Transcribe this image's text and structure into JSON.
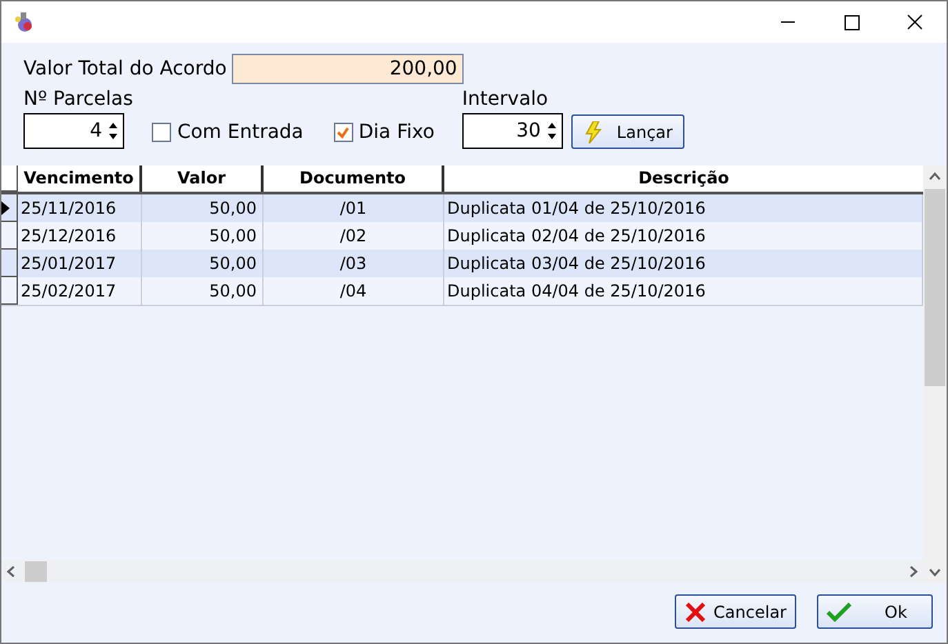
{
  "form": {
    "total_label": "Valor Total do Acordo",
    "total_value": "200,00",
    "parcelas_label": "Nº Parcelas",
    "parcelas_value": "4",
    "com_entrada": {
      "label": "Com Entrada",
      "checked": false
    },
    "dia_fixo": {
      "label": "Dia Fixo",
      "checked": true
    },
    "intervalo_label": "Intervalo",
    "intervalo_value": "30",
    "lancar": "Lançar"
  },
  "table": {
    "columns": [
      "Vencimento",
      "Valor",
      "Documento",
      "Descrição"
    ],
    "rows": [
      {
        "cells": [
          "25/11/2016",
          "50,00",
          "/01",
          "Duplicata 01/04 de 25/10/2016"
        ],
        "selected": true
      },
      {
        "cells": [
          "25/12/2016",
          "50,00",
          "/02",
          "Duplicata 02/04 de 25/10/2016"
        ],
        "selected": false
      },
      {
        "cells": [
          "25/01/2017",
          "50,00",
          "/03",
          "Duplicata 03/04 de 25/10/2016"
        ],
        "selected": false
      },
      {
        "cells": [
          "25/02/2017",
          "50,00",
          "/04",
          "Duplicata 04/04 de 25/10/2016"
        ],
        "selected": false
      }
    ]
  },
  "buttons": {
    "cancel": "Cancelar",
    "ok": "Ok"
  }
}
